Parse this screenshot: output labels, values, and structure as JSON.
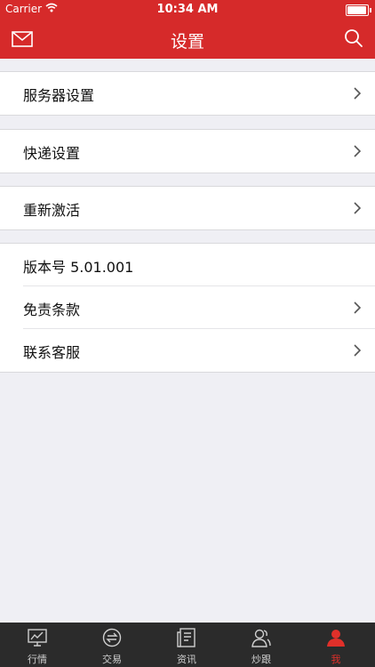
{
  "status_bar": {
    "carrier": "Carrier",
    "time": "10:34 AM",
    "battery_level": 0.95
  },
  "header": {
    "title": "设置",
    "left_icon": "mail-icon",
    "right_icon": "search-icon"
  },
  "settings": {
    "server": "服务器设置",
    "delivery": "快递设置",
    "reactivate": "重新激活",
    "version": "版本号 5.01.001",
    "disclaimer": "免责条款",
    "contact": "联系客服"
  },
  "tabs": [
    {
      "label": "行情",
      "icon": "chart-monitor-icon"
    },
    {
      "label": "交易",
      "icon": "exchange-icon"
    },
    {
      "label": "资讯",
      "icon": "news-icon"
    },
    {
      "label": "炒跟",
      "icon": "follow-users-icon"
    },
    {
      "label": "我",
      "icon": "profile-icon",
      "active": true
    }
  ],
  "colors": {
    "accent": "#d62a2a",
    "background": "#efeff4",
    "tabbar": "#2b2b2b",
    "tab_active": "#e0302a"
  }
}
